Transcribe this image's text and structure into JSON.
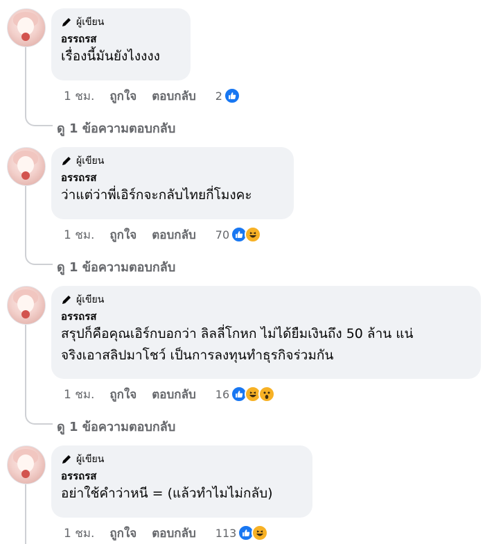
{
  "badge_label": "ผู้เขียน",
  "view_replies_label": "ดู 1 ข้อความตอบกลับ",
  "actions": {
    "like": "ถูกใจ",
    "reply": "ตอบกลับ"
  },
  "comments": [
    {
      "author": "อรรถรส",
      "text": "เรื่องนี้มันยังไงงงง",
      "time": "1 ชม.",
      "reaction_count": "2",
      "reactions": [
        "like"
      ]
    },
    {
      "author": "อรรถรส",
      "text": "ว่าแต่ว่าพี่เอิร์กจะกลับไทยกี่โมงคะ",
      "time": "1 ชม.",
      "reaction_count": "70",
      "reactions": [
        "like",
        "haha"
      ]
    },
    {
      "author": "อรรถรส",
      "text": "สรุปก็คือคุณเอิร์กบอกว่า ลิลลี่โกหก ไม่ได้ยืมเงินถึง 50 ล้าน แน่\nจริงเอาสลิปมาโชว์ เป็นการลงทุนทำธุรกิจร่วมกัน",
      "text_line1": "สรุปก็คือคุณเอิร์กบอกว่า ลิลลี่โกหก ไม่ได้ยืมเงินถึง 50 ล้าน แน่",
      "text_line2": "จริงเอาสลิปมาโชว์ เป็นการลงทุนทำธุรกิจร่วมกัน",
      "time": "1 ชม.",
      "reaction_count": "16",
      "reactions": [
        "like",
        "haha",
        "wow"
      ]
    },
    {
      "author": "อรรถรส",
      "text": "อย่าใช้คำว่าหนี = (แล้วทำไมไม่กลับ)",
      "time": "1 ชม.",
      "reaction_count": "113",
      "reactions": [
        "like",
        "haha"
      ]
    }
  ],
  "colors": {
    "bubble": "#f0f2f5",
    "secondary_text": "#65676b",
    "like_blue": "#1877f2",
    "emoji_yellow": "#f7b125",
    "thread_line": "#ced0d4"
  }
}
